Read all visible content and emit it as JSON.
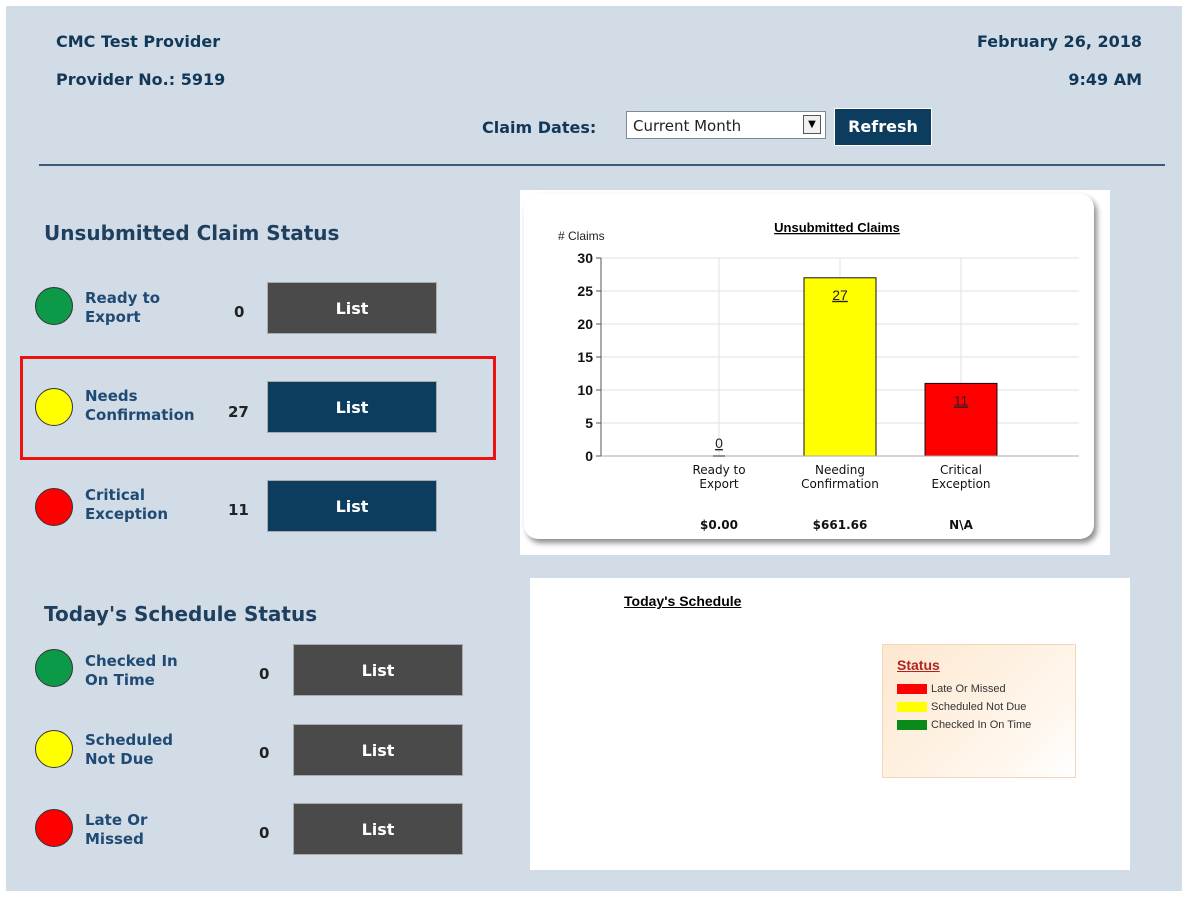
{
  "header": {
    "provider_name": "CMC Test Provider",
    "provider_no": "Provider No.: 5919",
    "date": "February 26, 2018",
    "time": "9:49 AM",
    "claim_dates_label": "Claim Dates:",
    "claim_dates_value": "Current Month",
    "refresh_label": "Refresh"
  },
  "claims": {
    "title": "Unsubmitted Claim Status",
    "items": [
      {
        "line1": "Ready to",
        "line2": "Export",
        "count": "0",
        "button": "List",
        "color": "#0c9a48"
      },
      {
        "line1": "Needs",
        "line2": "Confirmation",
        "count": "27",
        "button": "List",
        "color": "#ffff00"
      },
      {
        "line1": "Critical",
        "line2": "Exception",
        "count": "11",
        "button": "List",
        "color": "#ff0000"
      }
    ]
  },
  "schedule": {
    "title": "Today's Schedule Status",
    "items": [
      {
        "line1": "Checked In",
        "line2": "On Time",
        "count": "0",
        "button": "List",
        "color": "#0c9a48"
      },
      {
        "line1": "Scheduled",
        "line2": "Not Due",
        "count": "0",
        "button": "List",
        "color": "#ffff00"
      },
      {
        "line1": "Late Or",
        "line2": "Missed",
        "count": "0",
        "button": "List",
        "color": "#ff0000"
      }
    ]
  },
  "chart_data": {
    "type": "bar",
    "title": "Unsubmitted Claims",
    "ylabel": "# Claims",
    "ylim": [
      0,
      30
    ],
    "yticks": [
      "0",
      "5",
      "10",
      "15",
      "20",
      "25",
      "30"
    ],
    "categories": [
      "Ready to\nExport",
      "Needing\nConfirmation",
      "Critical\nException"
    ],
    "values": [
      0,
      27,
      11
    ],
    "amounts": [
      "$0.00",
      "$661.66",
      "N\\A"
    ],
    "colors": [
      "#d4d4d4",
      "#ffff00",
      "#ff0000"
    ],
    "grid": true
  },
  "todays_schedule": {
    "title": "Today's Schedule",
    "legend_title": "Status",
    "legend": [
      {
        "label": "Late Or Missed",
        "color": "#ff0000"
      },
      {
        "label": "Scheduled Not Due",
        "color": "#ffff00"
      },
      {
        "label": "Checked In On Time",
        "color": "#0a8a1a"
      }
    ]
  }
}
